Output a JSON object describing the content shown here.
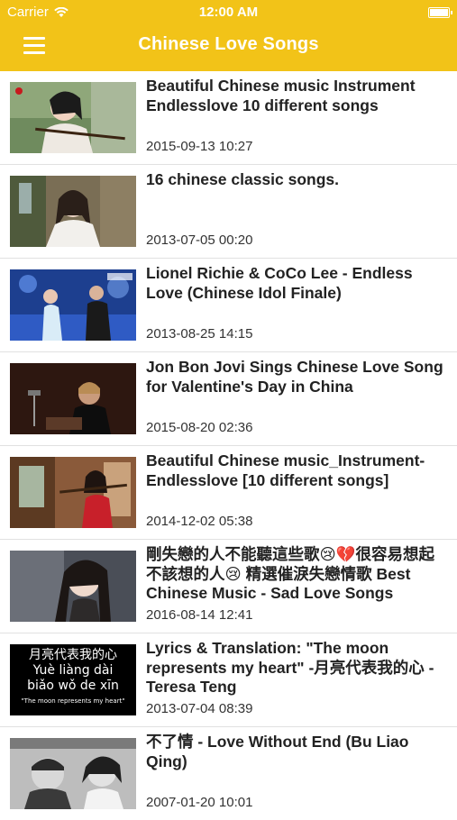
{
  "status_bar": {
    "carrier": "Carrier",
    "time": "12:00 AM"
  },
  "header": {
    "title": "Chinese Love Songs"
  },
  "videos": [
    {
      "title": "Beautiful Chinese music Instrument Endlesslove 10 different songs",
      "date": "2015-09-13 10:27"
    },
    {
      "title": "16 chinese classic songs.",
      "date": "2013-07-05 00:20"
    },
    {
      "title": "Lionel Richie & CoCo Lee - Endless Love (Chinese Idol Finale)",
      "date": "2013-08-25 14:15"
    },
    {
      "title": "Jon Bon Jovi Sings Chinese Love Song for Valentine's Day in China",
      "date": "2015-08-20 02:36"
    },
    {
      "title": "Beautiful Chinese music_Instrument-Endlesslove [10 different songs]",
      "date": "2014-12-02 05:38"
    },
    {
      "title": "剛失戀的人不能聽這些歌😢💔很容易想起不該想的人😢 精選催淚失戀情歌 Best Chinese Music - Sad Love Songs",
      "date": "2016-08-14 12:41"
    },
    {
      "title": "Lyrics & Translation: \"The moon represents my heart\" -月亮代表我的心 - Teresa Teng",
      "date": "2013-07-04 08:39"
    },
    {
      "title": "不了情 - Love Without End (Bu Liao Qing)",
      "date": "2007-01-20 10:01"
    }
  ],
  "thumb7_text": {
    "line1": "月亮代表我的心",
    "line2": "Yuè liàng dài",
    "line3": "biǎo wǒ de xīn",
    "line4": "\"The moon represents my heart\""
  }
}
